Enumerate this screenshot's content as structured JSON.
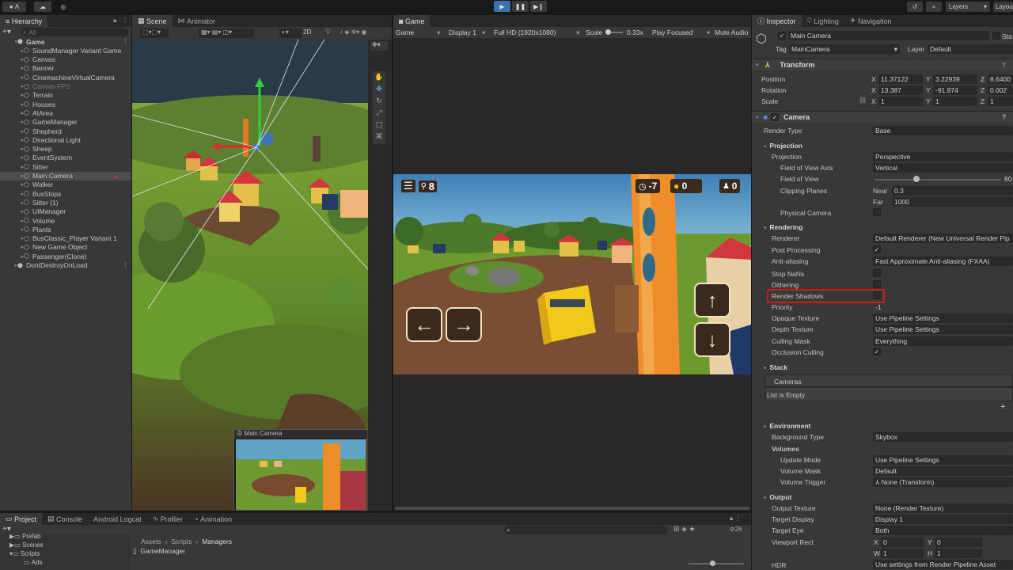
{
  "topbar": {
    "account": "A",
    "play_icon": "play-icon",
    "pause_icon": "pause-icon",
    "step_icon": "step-icon",
    "layers": "Layers",
    "layout": "Layout"
  },
  "hierarchy": {
    "tab": "Hierarchy",
    "search_placeholder": "All",
    "items": [
      {
        "label": "Game",
        "indent": 0,
        "bold": true,
        "expanded": true
      },
      {
        "label": "SoundManager Variant Game",
        "indent": 1
      },
      {
        "label": "Canvas",
        "indent": 1
      },
      {
        "label": "Banner",
        "indent": 1
      },
      {
        "label": "CinemachineVirtualCamera",
        "indent": 1
      },
      {
        "label": "Canvas FPS",
        "indent": 1,
        "dim": true
      },
      {
        "label": "Terrain",
        "indent": 1
      },
      {
        "label": "Houses",
        "indent": 1
      },
      {
        "label": "AIArea",
        "indent": 1
      },
      {
        "label": "GameManager",
        "indent": 1
      },
      {
        "label": "Shepherd",
        "indent": 1
      },
      {
        "label": "Directional Light",
        "indent": 1
      },
      {
        "label": "Sheep",
        "indent": 1
      },
      {
        "label": "EventSystem",
        "indent": 1
      },
      {
        "label": "Sitter",
        "indent": 1
      },
      {
        "label": "Main Camera",
        "indent": 1,
        "selected": true
      },
      {
        "label": "Walker",
        "indent": 1
      },
      {
        "label": "BusStops",
        "indent": 1
      },
      {
        "label": "Sitter (1)",
        "indent": 1
      },
      {
        "label": "UIManager",
        "indent": 1
      },
      {
        "label": "Volume",
        "indent": 1
      },
      {
        "label": "Plants",
        "indent": 1
      },
      {
        "label": "BusClassic_Player Variant 1",
        "indent": 1
      },
      {
        "label": "New Game Object",
        "indent": 1
      },
      {
        "label": "Passenger(Clone)",
        "indent": 1
      },
      {
        "label": "DontDestroyOnLoad",
        "indent": 0
      }
    ]
  },
  "scene": {
    "tabs": [
      "Scene",
      "Animator"
    ],
    "toolbar_2d": "2D",
    "camera_preview_title": "Main Camera"
  },
  "game": {
    "tab": "Game",
    "toolbar": {
      "mode": "Game",
      "display": "Display 1",
      "resolution": "Full HD (1920x1080)",
      "scale_label": "Scale",
      "scale_value": "0.33x",
      "play_focused": "Play Focused",
      "mute": "Mute Audio"
    },
    "hud": {
      "passengers": "8",
      "timer": "-7",
      "coins": "0",
      "people": "0"
    },
    "buttons": {
      "left": "←",
      "right": "→",
      "up": "↑",
      "down": "↓"
    }
  },
  "inspector": {
    "tabs": [
      "Inspector",
      "Lighting",
      "Navigation"
    ],
    "object_name": "Main Camera",
    "static": "Sta",
    "tag_label": "Tag",
    "tag_value": "MainCamera",
    "layer_label": "Layer",
    "layer_value": "Default",
    "transform": {
      "title": "Transform",
      "position": {
        "label": "Position",
        "x": "11.37122",
        "y": "3.22939",
        "z": "8.6400"
      },
      "rotation": {
        "label": "Rotation",
        "x": "13.387",
        "y": "-91.974",
        "z": "0.002"
      },
      "scale": {
        "label": "Scale",
        "x": "1",
        "y": "1",
        "z": "1"
      },
      "axis_x": "X",
      "axis_y": "Y",
      "axis_z": "Z"
    },
    "camera": {
      "title": "Camera",
      "render_type_label": "Render Type",
      "render_type": "Base",
      "projection_section": "Projection",
      "projection_label": "Projection",
      "projection": "Perspective",
      "fov_axis_label": "Field of View Axis",
      "fov_axis": "Vertical",
      "fov_label": "Field of View",
      "fov": "60",
      "clipping_label": "Clipping Planes",
      "near_label": "Near",
      "near": "0.3",
      "far_label": "Far",
      "far": "1000",
      "physical_label": "Physical Camera",
      "rendering_section": "Rendering",
      "renderer_label": "Renderer",
      "renderer": "Default Renderer (New Universal Render Pip",
      "post_label": "Post Processing",
      "aa_label": "Anti-aliasing",
      "aa": "Fast Approximate Anti-aliasing (FXAA)",
      "stopnans_label": "Stop NaNs",
      "dither_label": "Dithering",
      "shadows_label": "Render Shadows",
      "priority_label": "Priority",
      "priority": "-1",
      "opaque_label": "Opaque Texture",
      "opaque": "Use Pipeline Settings",
      "depth_label": "Depth Texture",
      "depth": "Use Pipeline Settings",
      "culling_label": "Culling Mask",
      "culling": "Everything",
      "occlusion_label": "Occlusion Culling",
      "stack_section": "Stack",
      "cameras_label": "Cameras",
      "list_empty": "List is Empty",
      "plus": "+",
      "env_section": "Environment",
      "bg_label": "Background Type",
      "bg": "Skybox",
      "volumes_label": "Volumes",
      "update_label": "Update Mode",
      "update": "Use Pipeline Settings",
      "vmask_label": "Volume Mask",
      "vmask": "Default",
      "vtrigger_label": "Volume Trigger",
      "vtrigger": "None (Transform)",
      "output_section": "Output",
      "otex_label": "Output Texture",
      "otex": "None (Render Texture)",
      "tdisplay_label": "Target Display",
      "tdisplay": "Display 1",
      "teye_label": "Target Eye",
      "teye": "Both",
      "vrect_label": "Viewport Rect",
      "vx": "0",
      "vy": "0",
      "vw": "1",
      "vh": "1",
      "vx_label": "X",
      "vy_label": "Y",
      "vw_label": "W",
      "vh_label": "H",
      "hdr_label": "HDR",
      "hdr": "Use settings from Render Pipeline Asset"
    }
  },
  "bottom": {
    "tabs": [
      "Project",
      "Console",
      "Android Logcat",
      "Profiler",
      "Animation"
    ],
    "folders": [
      "Prefab",
      "Scenes",
      "Scripts",
      "Ads"
    ],
    "breadcrumb": [
      "Assets",
      "Scripts",
      "Managers"
    ],
    "file": "GameManager",
    "count": "26"
  },
  "colors": {
    "highlight": "#d11a1a",
    "accent": "#3a72b0",
    "selection": "#4d4d4d"
  }
}
